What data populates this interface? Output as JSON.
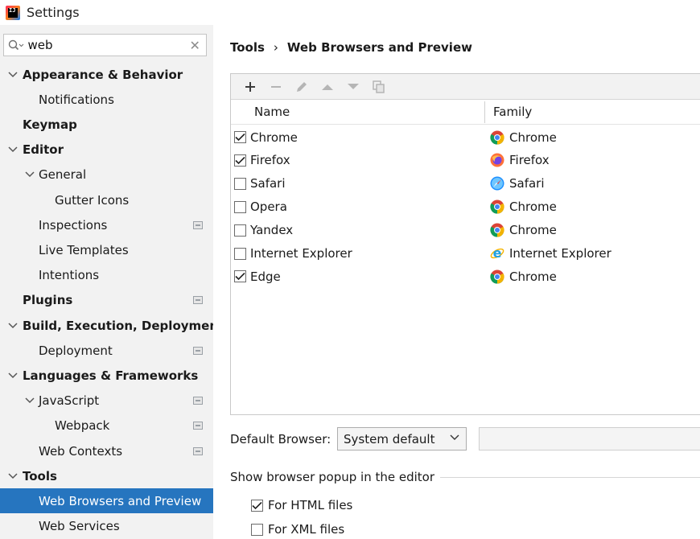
{
  "window": {
    "title": "Settings",
    "logo_text": "IJ"
  },
  "search": {
    "value": "web",
    "placeholder": ""
  },
  "tree": [
    {
      "label": "Appearance & Behavior",
      "bold": true,
      "level": 0,
      "expanded": true,
      "proj": false
    },
    {
      "label": "Notifications",
      "bold": false,
      "level": 1,
      "proj": false
    },
    {
      "label": "Keymap",
      "bold": true,
      "level": 0,
      "proj": false
    },
    {
      "label": "Editor",
      "bold": true,
      "level": 0,
      "expanded": true,
      "proj": false
    },
    {
      "label": "General",
      "bold": false,
      "level": 1,
      "expanded": true,
      "proj": false
    },
    {
      "label": "Gutter Icons",
      "bold": false,
      "level": 2,
      "proj": false
    },
    {
      "label": "Inspections",
      "bold": false,
      "level": 1,
      "proj": true
    },
    {
      "label": "Live Templates",
      "bold": false,
      "level": 1,
      "proj": false
    },
    {
      "label": "Intentions",
      "bold": false,
      "level": 1,
      "proj": false
    },
    {
      "label": "Plugins",
      "bold": true,
      "level": 0,
      "proj": true
    },
    {
      "label": "Build, Execution, Deployment",
      "bold": true,
      "level": 0,
      "expanded": true,
      "proj": false
    },
    {
      "label": "Deployment",
      "bold": false,
      "level": 1,
      "proj": true
    },
    {
      "label": "Languages & Frameworks",
      "bold": true,
      "level": 0,
      "expanded": true,
      "proj": false
    },
    {
      "label": "JavaScript",
      "bold": false,
      "level": 1,
      "expanded": true,
      "proj": true
    },
    {
      "label": "Webpack",
      "bold": false,
      "level": 2,
      "proj": true
    },
    {
      "label": "Web Contexts",
      "bold": false,
      "level": 1,
      "proj": true
    },
    {
      "label": "Tools",
      "bold": true,
      "level": 0,
      "expanded": true,
      "proj": false
    },
    {
      "label": "Web Browsers and Preview",
      "bold": false,
      "level": 1,
      "proj": false,
      "selected": true
    },
    {
      "label": "Web Services",
      "bold": false,
      "level": 1,
      "proj": false
    }
  ],
  "breadcrumb": {
    "parent": "Tools",
    "separator": "›",
    "current": "Web Browsers and Preview"
  },
  "table": {
    "col_name": "Name",
    "col_family": "Family",
    "rows": [
      {
        "name": "Chrome",
        "checked": true,
        "family": "Chrome",
        "icon": "chrome-icon"
      },
      {
        "name": "Firefox",
        "checked": true,
        "family": "Firefox",
        "icon": "firefox-icon"
      },
      {
        "name": "Safari",
        "checked": false,
        "family": "Safari",
        "icon": "safari-icon"
      },
      {
        "name": "Opera",
        "checked": false,
        "family": "Chrome",
        "icon": "chrome-icon"
      },
      {
        "name": "Yandex",
        "checked": false,
        "family": "Chrome",
        "icon": "chrome-icon"
      },
      {
        "name": "Internet Explorer",
        "checked": false,
        "family": "Internet Explorer",
        "icon": "ie-icon"
      },
      {
        "name": "Edge",
        "checked": true,
        "family": "Chrome",
        "icon": "chrome-icon"
      }
    ]
  },
  "default_browser": {
    "label": "Default Browser:",
    "selected": "System default",
    "path": ""
  },
  "popup": {
    "title": "Show browser popup in the editor",
    "html_label": "For HTML files",
    "html_checked": true,
    "xml_label": "For XML files",
    "xml_checked": false
  },
  "colors": {
    "selection": "#2675bf",
    "sidebar_bg": "#f2f2f2"
  }
}
